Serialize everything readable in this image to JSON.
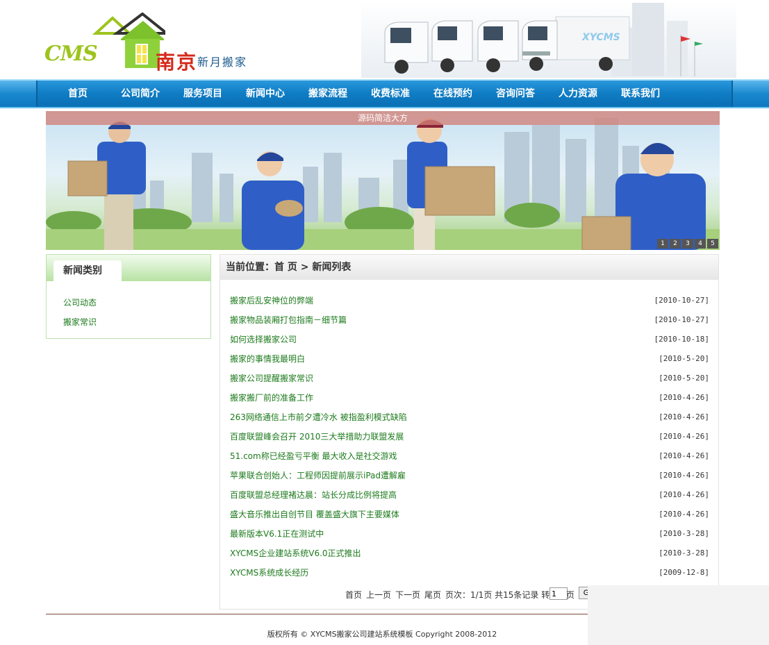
{
  "logo": {
    "cms": "CMS",
    "city": "南京",
    "subtitle": "新月搬家"
  },
  "colors": {
    "nav_bg": "#0f7cc4",
    "link_green": "#1d7a1d",
    "logo_green": "#9dc41e",
    "logo_red": "#d42a1c",
    "caption_bg": "#d2827a"
  },
  "truck_label": "XYCMS",
  "nav": [
    "首页",
    "公司简介",
    "服务项目",
    "新闻中心",
    "搬家流程",
    "收费标准",
    "在线预约",
    "咨询问答",
    "人力资源",
    "联系我们"
  ],
  "banner": {
    "caption": "源码简洁大方",
    "dots": [
      "1",
      "2",
      "3",
      "4",
      "5"
    ]
  },
  "sidebar": {
    "title": "新闻类别",
    "items": [
      "公司动态",
      "搬家常识"
    ]
  },
  "main": {
    "breadcrumb": "当前位置：首 页 > 新闻列表"
  },
  "news": [
    {
      "title": "搬家后乱安神位的弊端",
      "date": "[2010-10-27]"
    },
    {
      "title": "搬家物品装厢打包指南－细节篇",
      "date": "[2010-10-27]"
    },
    {
      "title": "如何选择搬家公司",
      "date": "[2010-10-18]"
    },
    {
      "title": "搬家的事情我最明白",
      "date": "[2010-5-20]"
    },
    {
      "title": "搬家公司提醒搬家常识",
      "date": "[2010-5-20]"
    },
    {
      "title": "搬家搬厂前的准备工作",
      "date": "[2010-4-26]"
    },
    {
      "title": "263网络通信上市前夕遭冷水 被指盈利模式缺陷",
      "date": "[2010-4-26]"
    },
    {
      "title": "百度联盟峰会召开 2010三大举措助力联盟发展",
      "date": "[2010-4-26]"
    },
    {
      "title": "51.com称已经盈亏平衡 最大收入是社交游戏",
      "date": "[2010-4-26]"
    },
    {
      "title": "苹果联合创始人：工程师因提前展示iPad遭解雇",
      "date": "[2010-4-26]"
    },
    {
      "title": "百度联盟总经理褚达晨：站长分成比例将提高",
      "date": "[2010-4-26]"
    },
    {
      "title": "盛大音乐推出自创节目 覆盖盛大旗下主要媒体",
      "date": "[2010-4-26]"
    },
    {
      "title": "最新版本V6.1正在测试中",
      "date": "[2010-3-28]"
    },
    {
      "title": "XYCMS企业建站系统V6.0正式推出",
      "date": "[2010-3-28]"
    },
    {
      "title": "XYCMS系统成长经历",
      "date": "[2009-12-8]"
    }
  ],
  "pager": {
    "first": "首页",
    "prev": "上一页",
    "next": "下一页",
    "last": "尾页",
    "info": "页次：1/1页 共15条记录 转",
    "page_value": "1",
    "page_unit": "页",
    "go": "G"
  },
  "footer": {
    "copyright": "版权所有 © XYCMS搬家公司建站系统模板  Copyright 2008-2012"
  }
}
